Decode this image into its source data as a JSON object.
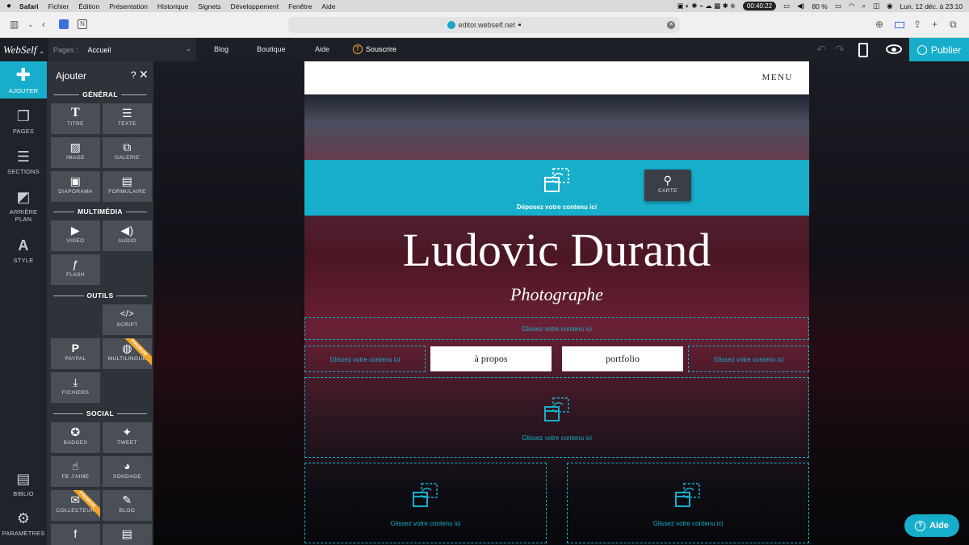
{
  "mac_menu": {
    "apple": "",
    "items": [
      "Safari",
      "Fichier",
      "Édition",
      "Présentation",
      "Historique",
      "Signets",
      "Développement",
      "Fenêtre",
      "Aide"
    ],
    "time_pill": "00:40:22",
    "battery": "80 %",
    "clock": "Lun. 12 déc. à 23:10"
  },
  "browser": {
    "url": "editor.webself.net"
  },
  "editor_bar": {
    "logo": "WebSelf",
    "pages_label": "Pages :",
    "page_value": "Accueil",
    "nav": [
      "Blog",
      "Boutique",
      "Aide"
    ],
    "subscribe": "Souscrire",
    "publish": "Publier"
  },
  "left_nav": {
    "items": [
      {
        "label": "AJOUTER",
        "icon": "plus-icon",
        "glyph": "✚"
      },
      {
        "label": "PAGES",
        "icon": "pages-icon",
        "glyph": "❐"
      },
      {
        "label": "SECTIONS",
        "icon": "sections-icon",
        "glyph": "☰"
      },
      {
        "label": "ARRIÈRE PLAN",
        "icon": "background-icon",
        "glyph": "◩"
      },
      {
        "label": "STYLE",
        "icon": "style-icon",
        "glyph": "A"
      },
      {
        "label": "BIBLIO",
        "icon": "library-icon",
        "glyph": "▤"
      },
      {
        "label": "PARAMÈTRES",
        "icon": "gear-icon",
        "glyph": "⚙"
      }
    ]
  },
  "add_panel": {
    "title": "Ajouter",
    "help": "?",
    "close": "✕",
    "sections": {
      "general": "GÉNÉRAL",
      "multimedia": "MULTIMÉDIA",
      "outils": "OUTILS",
      "social": "SOCIAL"
    },
    "tiles": {
      "titre": "TITRE",
      "texte": "TEXTE",
      "image": "IMAGE",
      "galerie": "GALERIE",
      "diaporama": "DIAPORAMA",
      "formulaire": "FORMULAIRE",
      "video": "VIDÉO",
      "audio": "AUDIO",
      "flash": "FLASH",
      "script": "SCRIPT",
      "paypal": "PAYPAL",
      "multilingue": "MULTILINGUE",
      "fichiers": "FICHIERS",
      "badges": "BADGES",
      "tweet": "TWEET",
      "fb_aime": "FB J'AIME",
      "sondage": "SONDAGE",
      "collecteur": "COLLECTEUR",
      "blog": "BLOG"
    },
    "premium": "PREMIUM"
  },
  "site": {
    "menu": "MENU",
    "drop_label": "Déposez votre contenu ici",
    "carte": "CARTE",
    "name": "Ludovic Durand",
    "profession": "Photographe",
    "glissez": "Glissez votre contenu ici",
    "btn_about": "à propos",
    "btn_portfolio": "portfolio"
  },
  "help_button": "Aide",
  "colors": {
    "accent": "#17aecb",
    "premium": "#f0a52a",
    "panel": "#2e3239"
  }
}
